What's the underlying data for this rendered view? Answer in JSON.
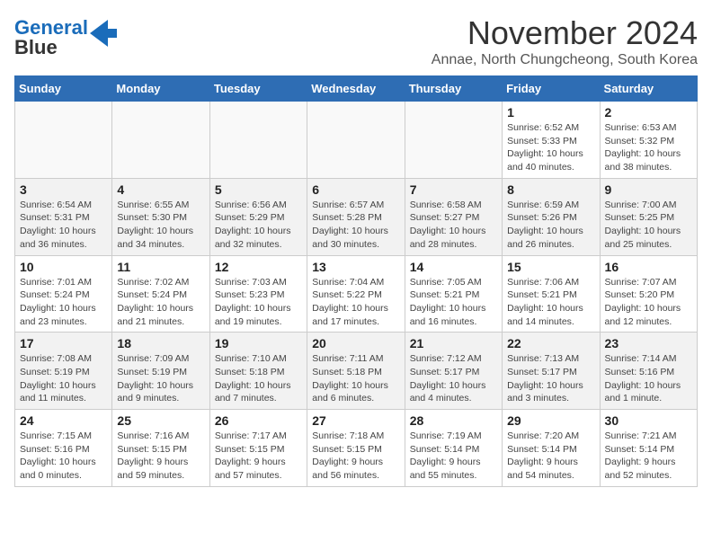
{
  "logo": {
    "part1": "General",
    "part2": "Blue"
  },
  "title": "November 2024",
  "subtitle": "Annae, North Chungcheong, South Korea",
  "weekdays": [
    "Sunday",
    "Monday",
    "Tuesday",
    "Wednesday",
    "Thursday",
    "Friday",
    "Saturday"
  ],
  "weeks": [
    [
      {
        "day": "",
        "info": ""
      },
      {
        "day": "",
        "info": ""
      },
      {
        "day": "",
        "info": ""
      },
      {
        "day": "",
        "info": ""
      },
      {
        "day": "",
        "info": ""
      },
      {
        "day": "1",
        "info": "Sunrise: 6:52 AM\nSunset: 5:33 PM\nDaylight: 10 hours\nand 40 minutes."
      },
      {
        "day": "2",
        "info": "Sunrise: 6:53 AM\nSunset: 5:32 PM\nDaylight: 10 hours\nand 38 minutes."
      }
    ],
    [
      {
        "day": "3",
        "info": "Sunrise: 6:54 AM\nSunset: 5:31 PM\nDaylight: 10 hours\nand 36 minutes."
      },
      {
        "day": "4",
        "info": "Sunrise: 6:55 AM\nSunset: 5:30 PM\nDaylight: 10 hours\nand 34 minutes."
      },
      {
        "day": "5",
        "info": "Sunrise: 6:56 AM\nSunset: 5:29 PM\nDaylight: 10 hours\nand 32 minutes."
      },
      {
        "day": "6",
        "info": "Sunrise: 6:57 AM\nSunset: 5:28 PM\nDaylight: 10 hours\nand 30 minutes."
      },
      {
        "day": "7",
        "info": "Sunrise: 6:58 AM\nSunset: 5:27 PM\nDaylight: 10 hours\nand 28 minutes."
      },
      {
        "day": "8",
        "info": "Sunrise: 6:59 AM\nSunset: 5:26 PM\nDaylight: 10 hours\nand 26 minutes."
      },
      {
        "day": "9",
        "info": "Sunrise: 7:00 AM\nSunset: 5:25 PM\nDaylight: 10 hours\nand 25 minutes."
      }
    ],
    [
      {
        "day": "10",
        "info": "Sunrise: 7:01 AM\nSunset: 5:24 PM\nDaylight: 10 hours\nand 23 minutes."
      },
      {
        "day": "11",
        "info": "Sunrise: 7:02 AM\nSunset: 5:24 PM\nDaylight: 10 hours\nand 21 minutes."
      },
      {
        "day": "12",
        "info": "Sunrise: 7:03 AM\nSunset: 5:23 PM\nDaylight: 10 hours\nand 19 minutes."
      },
      {
        "day": "13",
        "info": "Sunrise: 7:04 AM\nSunset: 5:22 PM\nDaylight: 10 hours\nand 17 minutes."
      },
      {
        "day": "14",
        "info": "Sunrise: 7:05 AM\nSunset: 5:21 PM\nDaylight: 10 hours\nand 16 minutes."
      },
      {
        "day": "15",
        "info": "Sunrise: 7:06 AM\nSunset: 5:21 PM\nDaylight: 10 hours\nand 14 minutes."
      },
      {
        "day": "16",
        "info": "Sunrise: 7:07 AM\nSunset: 5:20 PM\nDaylight: 10 hours\nand 12 minutes."
      }
    ],
    [
      {
        "day": "17",
        "info": "Sunrise: 7:08 AM\nSunset: 5:19 PM\nDaylight: 10 hours\nand 11 minutes."
      },
      {
        "day": "18",
        "info": "Sunrise: 7:09 AM\nSunset: 5:19 PM\nDaylight: 10 hours\nand 9 minutes."
      },
      {
        "day": "19",
        "info": "Sunrise: 7:10 AM\nSunset: 5:18 PM\nDaylight: 10 hours\nand 7 minutes."
      },
      {
        "day": "20",
        "info": "Sunrise: 7:11 AM\nSunset: 5:18 PM\nDaylight: 10 hours\nand 6 minutes."
      },
      {
        "day": "21",
        "info": "Sunrise: 7:12 AM\nSunset: 5:17 PM\nDaylight: 10 hours\nand 4 minutes."
      },
      {
        "day": "22",
        "info": "Sunrise: 7:13 AM\nSunset: 5:17 PM\nDaylight: 10 hours\nand 3 minutes."
      },
      {
        "day": "23",
        "info": "Sunrise: 7:14 AM\nSunset: 5:16 PM\nDaylight: 10 hours\nand 1 minute."
      }
    ],
    [
      {
        "day": "24",
        "info": "Sunrise: 7:15 AM\nSunset: 5:16 PM\nDaylight: 10 hours\nand 0 minutes."
      },
      {
        "day": "25",
        "info": "Sunrise: 7:16 AM\nSunset: 5:15 PM\nDaylight: 9 hours\nand 59 minutes."
      },
      {
        "day": "26",
        "info": "Sunrise: 7:17 AM\nSunset: 5:15 PM\nDaylight: 9 hours\nand 57 minutes."
      },
      {
        "day": "27",
        "info": "Sunrise: 7:18 AM\nSunset: 5:15 PM\nDaylight: 9 hours\nand 56 minutes."
      },
      {
        "day": "28",
        "info": "Sunrise: 7:19 AM\nSunset: 5:14 PM\nDaylight: 9 hours\nand 55 minutes."
      },
      {
        "day": "29",
        "info": "Sunrise: 7:20 AM\nSunset: 5:14 PM\nDaylight: 9 hours\nand 54 minutes."
      },
      {
        "day": "30",
        "info": "Sunrise: 7:21 AM\nSunset: 5:14 PM\nDaylight: 9 hours\nand 52 minutes."
      }
    ]
  ]
}
